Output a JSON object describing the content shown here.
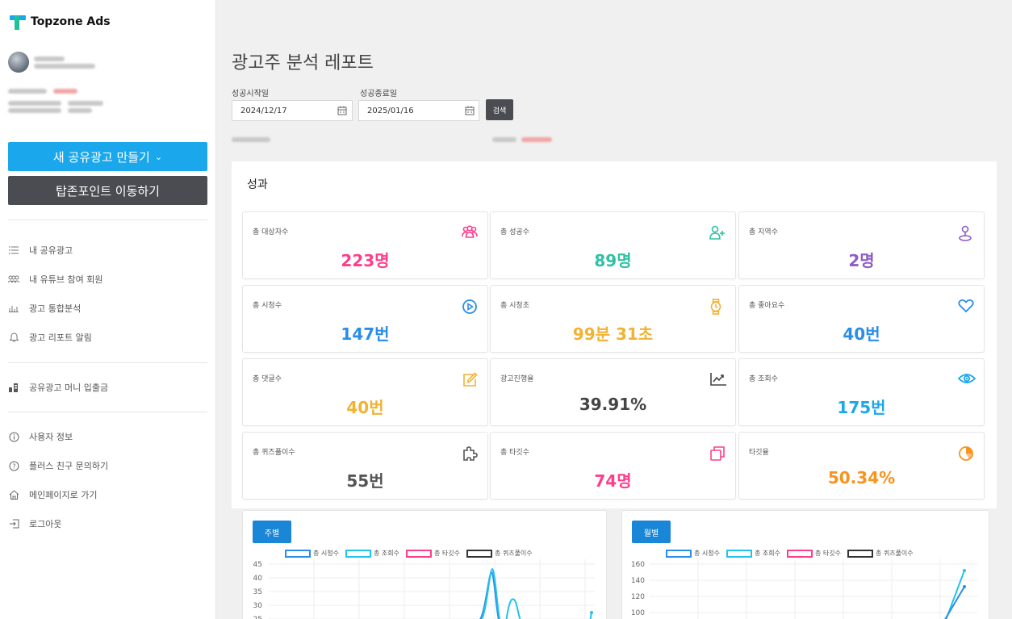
{
  "app": {
    "title": "Topzone Ads"
  },
  "sidebar": {
    "create_button": "새 공유광고 만들기",
    "points_button": "탑존포인트 이동하기",
    "menu": [
      {
        "label": "내 공유광고",
        "icon": "list-icon"
      },
      {
        "label": "내 유튜브 참여 회원",
        "icon": "group-icon"
      },
      {
        "label": "광고 통합분석",
        "icon": "bar-chart-icon"
      },
      {
        "label": "광고 리포트 알림",
        "icon": "bell-icon"
      },
      {
        "label": "공유광고 머니 입출금",
        "icon": "wallet-icon"
      },
      {
        "label": "사용자 정보",
        "icon": "info-icon"
      },
      {
        "label": "플러스 친구 문의하기",
        "icon": "question-icon"
      },
      {
        "label": "메인페이지로 가기",
        "icon": "home-icon"
      },
      {
        "label": "로그아웃",
        "icon": "logout-icon"
      }
    ]
  },
  "main": {
    "title": "광고주 분석 레포트",
    "start_label": "성공시작일",
    "end_label": "성공종료일",
    "start_date": "2024/12/17",
    "end_date": "2025/01/16",
    "search_button": "검색",
    "section_title": "성과"
  },
  "cards": [
    {
      "label": "총 대상자수",
      "value": "223명",
      "color": "#ff3d8b",
      "icon": "group-icon"
    },
    {
      "label": "총 성공수",
      "value": "89명",
      "color": "#2ec1a4",
      "icon": "add-user-icon"
    },
    {
      "label": "총 지역수",
      "value": "2명",
      "color": "#8e5cc7",
      "icon": "map-pin-icon"
    },
    {
      "label": "총 시청수",
      "value": "147번",
      "color": "#2a8ee8",
      "icon": "play-icon"
    },
    {
      "label": "총 시청초",
      "value": "99분 31초",
      "color": "#f2b232",
      "icon": "watch-icon"
    },
    {
      "label": "총 좋아요수",
      "value": "40번",
      "color": "#2a8ee8",
      "icon": "heart-icon"
    },
    {
      "label": "총 댓글수",
      "value": "40번",
      "color": "#f2b232",
      "icon": "edit-icon"
    },
    {
      "label": "광고진행율",
      "value": "39.91%",
      "color": "#444444",
      "icon": "trend-icon"
    },
    {
      "label": "총 조회수",
      "value": "175번",
      "color": "#1aa7ec",
      "icon": "eye-icon"
    },
    {
      "label": "총 퀴즈풀이수",
      "value": "55번",
      "color": "#555555",
      "icon": "puzzle-icon"
    },
    {
      "label": "총 타깃수",
      "value": "74명",
      "color": "#ff3d8b",
      "icon": "copy-icon"
    },
    {
      "label": "타깃율",
      "value": "50.34%",
      "color": "#f7931e",
      "icon": "pie-icon"
    }
  ],
  "charts": {
    "weekly": {
      "tab": "주별"
    },
    "monthly": {
      "tab": "월별"
    },
    "legend": [
      {
        "label": "총 시청수",
        "color": "#2a8ee8"
      },
      {
        "label": "총 조회수",
        "color": "#22c3ee"
      },
      {
        "label": "총 타깃수",
        "color": "#ff3d8b"
      },
      {
        "label": "총 퀴즈풀이수",
        "color": "#333333"
      }
    ],
    "weekly_ticks": [
      "45",
      "40",
      "35",
      "30",
      "25"
    ],
    "monthly_ticks": [
      "160",
      "140",
      "120",
      "100"
    ]
  },
  "chart_data": [
    {
      "type": "line",
      "title": "",
      "ylim": [
        25,
        45
      ],
      "series": [
        {
          "name": "총 시청수",
          "values": []
        },
        {
          "name": "총 조회수",
          "values": []
        },
        {
          "name": "총 타깃수",
          "values": []
        },
        {
          "name": "총 퀴즈풀이수",
          "values": []
        }
      ]
    },
    {
      "type": "line",
      "title": "",
      "ylim": [
        100,
        160
      ],
      "series": [
        {
          "name": "총 시청수",
          "values": []
        },
        {
          "name": "총 조회수",
          "values": []
        },
        {
          "name": "총 타깃수",
          "values": []
        },
        {
          "name": "총 퀴즈풀이수",
          "values": []
        }
      ]
    }
  ]
}
